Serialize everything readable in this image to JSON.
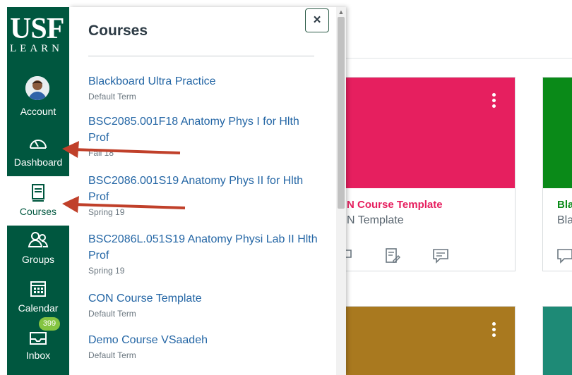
{
  "brand": {
    "logo_main": "USF",
    "logo_sub": "LEARN"
  },
  "colors": {
    "nav_bg": "#00573f",
    "link": "#2466a5",
    "card_pink": "#e61f5f",
    "card_green": "#0a8a18",
    "card_gold": "#a9791f",
    "card_teal": "#1e8a76",
    "arrow": "#c0402a"
  },
  "global_nav": {
    "items": [
      {
        "label": "Account",
        "icon": "avatar"
      },
      {
        "label": "Dashboard",
        "icon": "dashboard-icon"
      },
      {
        "label": "Courses",
        "icon": "courses-icon",
        "active": true
      },
      {
        "label": "Groups",
        "icon": "groups-icon"
      },
      {
        "label": "Calendar",
        "icon": "calendar-icon"
      },
      {
        "label": "Inbox",
        "icon": "inbox-icon",
        "badge": "399"
      }
    ]
  },
  "tray": {
    "title": "Courses",
    "close_label": "×",
    "courses": [
      {
        "name": "Blackboard Ultra Practice",
        "term": "Default Term"
      },
      {
        "name": "BSC2085.001F18 Anatomy Phys I for Hlth Prof",
        "term": "Fall 18"
      },
      {
        "name": "BSC2086.001S19 Anatomy Phys II for Hlth Prof",
        "term": "Spring 19"
      },
      {
        "name": "BSC2086L.051S19 Anatomy Physi Lab II Hlth Prof",
        "term": "Spring 19"
      },
      {
        "name": "CON Course Template",
        "term": "Default Term"
      },
      {
        "name": "Demo Course VSaadeh",
        "term": "Default Term"
      }
    ]
  },
  "cards": [
    {
      "title": "N Course Template",
      "subtitle": "N Template"
    },
    {
      "title": "Bla",
      "subtitle": "Bla"
    }
  ]
}
